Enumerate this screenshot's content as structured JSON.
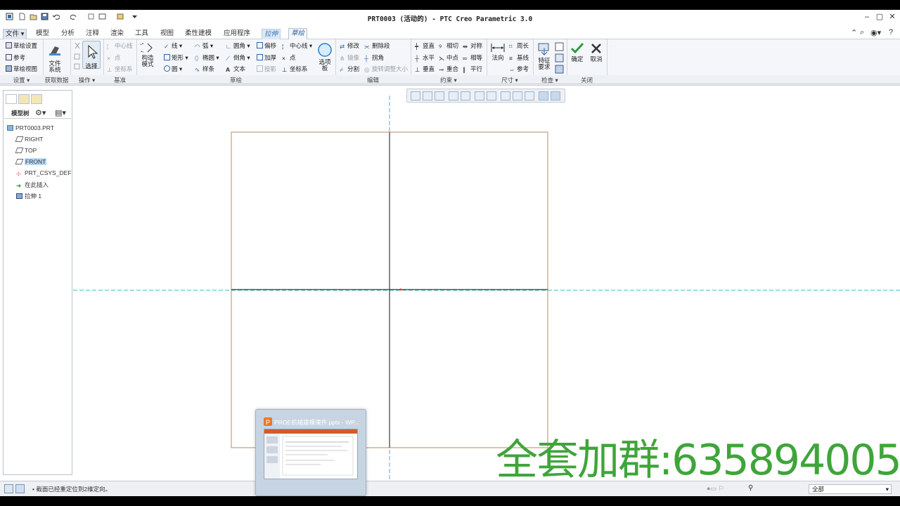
{
  "window": {
    "title": "PRT0003 (活动的) - PTC Creo Parametric 3.0"
  },
  "tabs": [
    "文件",
    "模型",
    "分析",
    "注释",
    "渲染",
    "工具",
    "视图",
    "柔性建模",
    "应用程序",
    "拉伸",
    "草绘"
  ],
  "ribbon": {
    "setup": {
      "items": [
        "草绘设置",
        "参考",
        "草绘视图"
      ],
      "label": "设置"
    },
    "getdata": {
      "btn": "文件\n系统",
      "label": "获取数据"
    },
    "ops": {
      "select": "选择",
      "label": "操作"
    },
    "datum": {
      "items": [
        "中心线",
        "点",
        "坐标系"
      ],
      "label": "基准"
    },
    "sketch": {
      "construct": "构造\n模式",
      "col1": [
        "线",
        "矩形",
        "圆"
      ],
      "col2": [
        "弧",
        "椭圆",
        "样条"
      ],
      "col3": [
        "圆角",
        "倒角",
        "文本"
      ],
      "col4": [
        "偏移",
        "加厚",
        "投影"
      ],
      "col5": [
        "中心线",
        "点",
        "坐标系"
      ],
      "palette": "选项\n板",
      "label": "草绘"
    },
    "edit": {
      "col1": [
        "修改",
        "镜像",
        "分割"
      ],
      "col2": [
        "删除段",
        "拐角",
        "旋转调整大小"
      ],
      "label": "编辑"
    },
    "constrain": {
      "col1": [
        "竖直",
        "水平",
        "垂直"
      ],
      "col2": [
        "相切",
        "中点",
        "重合"
      ],
      "col3": [
        "对称",
        "相等",
        "平行"
      ],
      "label": "约束"
    },
    "dimension": {
      "normal": "法向",
      "items": [
        "周长",
        "基线",
        "参考"
      ],
      "label": "尺寸"
    },
    "inspect": {
      "btn": "特征\n要求",
      "label": "检查"
    },
    "close": {
      "ok": "确定",
      "cancel": "取消",
      "label": "关闭"
    }
  },
  "model_tree": {
    "header": "模型树",
    "items": [
      "PRT0003.PRT",
      "RIGHT",
      "TOP",
      "FRONT",
      "PRT_CSYS_DEF",
      "在此插入",
      "拉伸 1"
    ]
  },
  "status": {
    "message": "截面已经重定位到2维定向。",
    "filter": "全部"
  },
  "taskbar_preview": {
    "title": "PROE机械建模课件.pptx - WP..."
  },
  "watermark": "全套加群:635894005",
  "colors": {
    "sketch_lines": "#b58b63",
    "datum": "#39b9c9",
    "accent": "#2f64a5",
    "watermark": "#3fa53a"
  }
}
